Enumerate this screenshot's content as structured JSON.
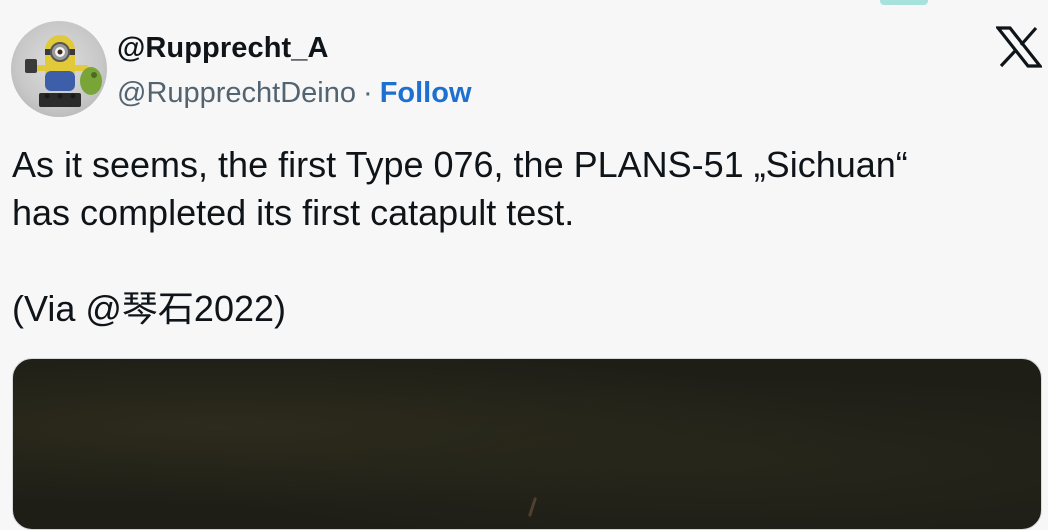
{
  "tweet": {
    "author": {
      "display_name": "@Rupprecht_A",
      "handle": "@RupprechtDeino",
      "separator": "·",
      "follow_label": "Follow",
      "avatar_icon": "minion-avatar-icon"
    },
    "platform_icon": "x-logo-icon",
    "text": {
      "line1": "As it seems, the first Type 076, the PLANS-51 „Sichuan“",
      "line2": "has completed its first catapult test.",
      "line3": "(Via @琴石2022)"
    },
    "media": {
      "type": "photo"
    }
  },
  "colors": {
    "background": "#f7f7f8",
    "text_primary": "#0f1419",
    "text_secondary": "#536471",
    "follow_link": "#1d6fd1",
    "accent_top": "#a7e3dc",
    "media_bg": "#1e1e17"
  }
}
